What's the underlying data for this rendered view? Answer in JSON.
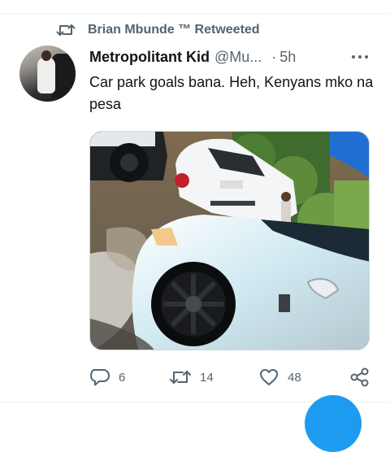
{
  "retweet": {
    "icon": "retweet-icon",
    "label": "Brian Mbunde ™ Retweeted"
  },
  "tweet": {
    "avatar_icon": "user-avatar",
    "display_name": "Metropolitant Kid",
    "handle": "@Mu...",
    "separator": "·",
    "time": "5h",
    "text": "Car park goals bana. Heh, Kenyans mko na pesa",
    "media_description": "photo of white cars parked in a wet compound"
  },
  "actions": {
    "reply_count": "6",
    "retweet_count": "14",
    "like_count": "48"
  },
  "colors": {
    "accent": "#1d9bf0",
    "text_primary": "#0f1419",
    "text_secondary": "#536471"
  }
}
